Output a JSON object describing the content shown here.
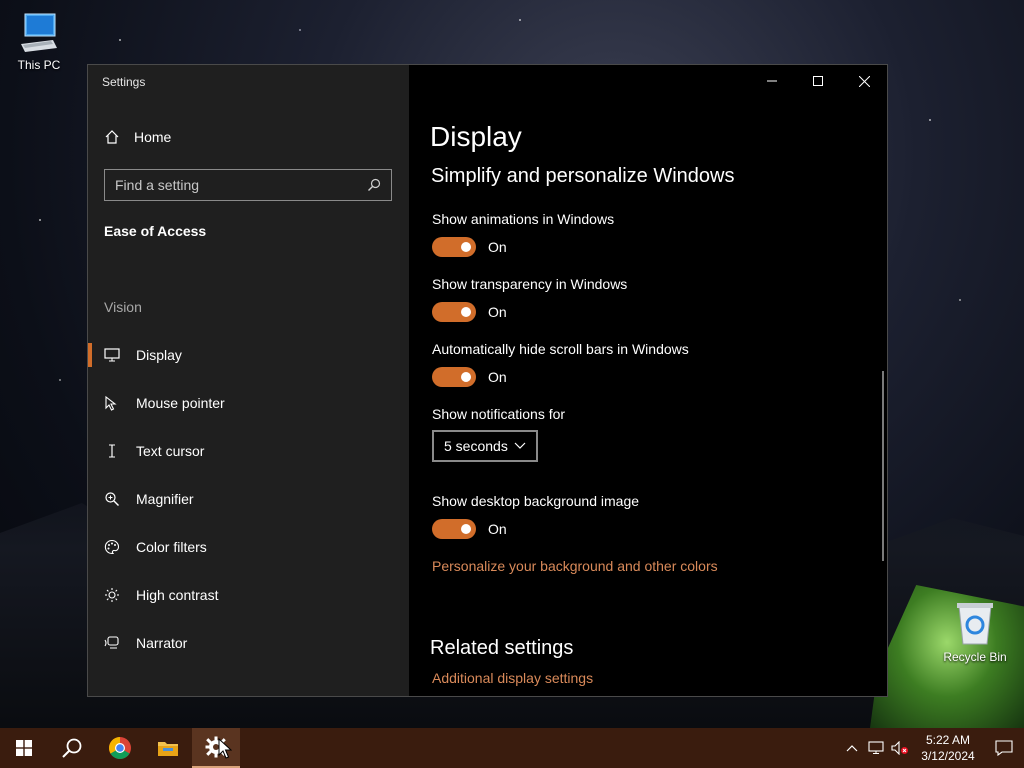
{
  "desktop": {
    "icons": [
      {
        "label": "This PC"
      },
      {
        "label": "Recycle Bin"
      }
    ]
  },
  "window": {
    "title": "Settings",
    "caption": {
      "minimize": "minimize-icon",
      "maximize": "maximize-icon",
      "close": "close-icon"
    }
  },
  "sidebar": {
    "home_label": "Home",
    "search_placeholder": "Find a setting",
    "section_title": "Ease of Access",
    "group_label": "Vision",
    "items": [
      {
        "label": "Display",
        "icon": "display-icon",
        "active": true
      },
      {
        "label": "Mouse pointer",
        "icon": "mouse-pointer-icon"
      },
      {
        "label": "Text cursor",
        "icon": "text-cursor-icon"
      },
      {
        "label": "Magnifier",
        "icon": "magnifier-icon"
      },
      {
        "label": "Color filters",
        "icon": "color-filters-icon"
      },
      {
        "label": "High contrast",
        "icon": "high-contrast-icon"
      },
      {
        "label": "Narrator",
        "icon": "narrator-icon"
      }
    ]
  },
  "content": {
    "page_title": "Display",
    "subtitle": "Simplify and personalize Windows",
    "settings": [
      {
        "label": "Show animations in Windows",
        "state": "On"
      },
      {
        "label": "Show transparency in Windows",
        "state": "On"
      },
      {
        "label": "Automatically hide scroll bars in Windows",
        "state": "On"
      }
    ],
    "notifications_label": "Show notifications for",
    "notifications_value": "5 seconds",
    "background_label": "Show desktop background image",
    "background_state": "On",
    "personalize_link": "Personalize your background and other colors",
    "related_title": "Related settings",
    "related_link": "Additional display settings"
  },
  "taskbar": {
    "time": "5:22 AM",
    "date": "3/12/2024"
  },
  "colors": {
    "accent": "#d16d2a",
    "link": "#d98a5a",
    "taskbar": "#3a1c0e",
    "sidebar": "#1f1f1f"
  }
}
